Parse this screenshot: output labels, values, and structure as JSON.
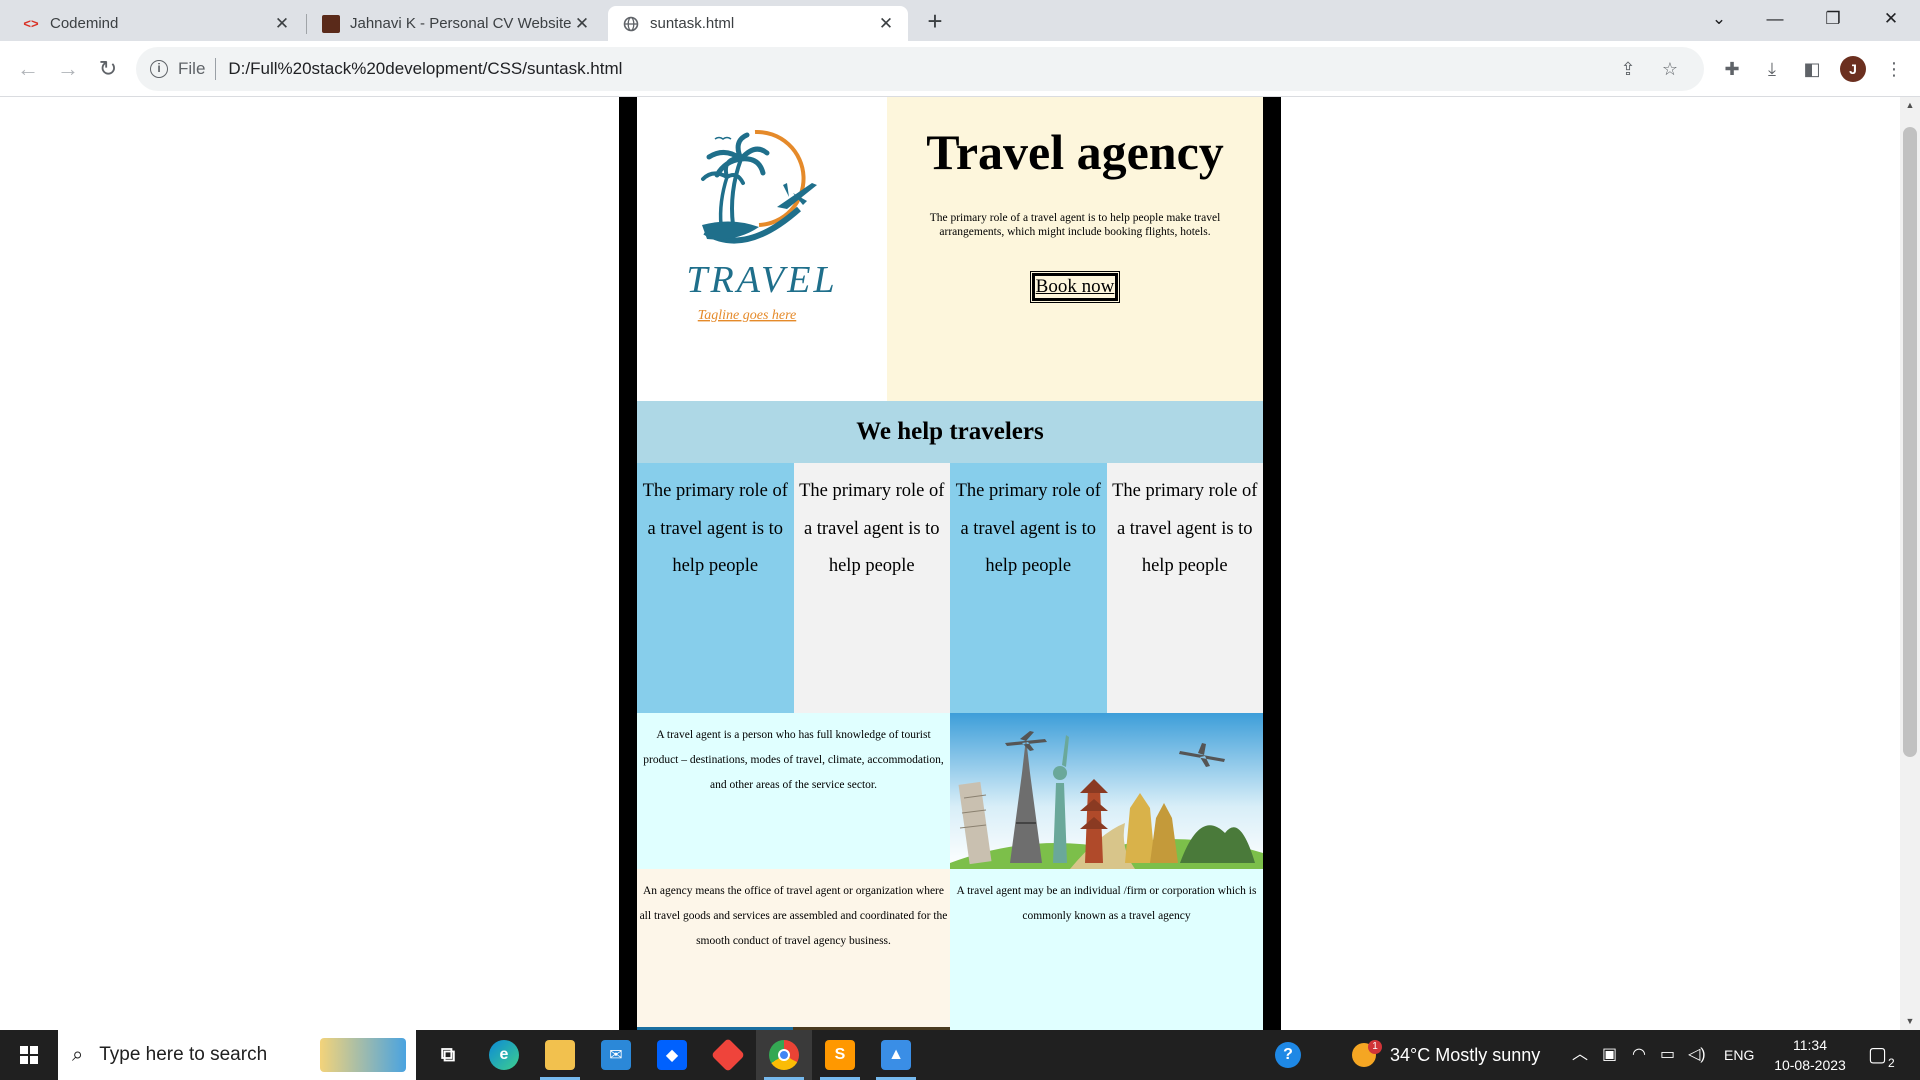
{
  "browser": {
    "tabs": [
      {
        "title": "Codemind",
        "favicon": "codemind-icon",
        "active": false
      },
      {
        "title": "Jahnavi K - Personal CV Website",
        "favicon": "portfolio-icon",
        "active": false
      },
      {
        "title": "suntask.html",
        "favicon": "globe-icon",
        "active": true
      }
    ],
    "address": {
      "scheme_label": "File",
      "url": "D:/Full%20stack%20development/CSS/suntask.html"
    },
    "profile_initial": "J"
  },
  "page": {
    "logo": {
      "wordmark": "TRAVEL",
      "tagline": "Tagline goes here"
    },
    "hero": {
      "title": "Travel agency",
      "description": "The primary role of a travel agent is to help people make travel arrangements, which might include booking flights, hotels.",
      "cta": "Book now"
    },
    "help_heading": "We help travelers",
    "columns": [
      {
        "text": "The primary role of a travel agent is to help people",
        "color": "#87ceeb"
      },
      {
        "text": "The primary role of a travel agent is to help people",
        "color": "#f2f2f2"
      },
      {
        "text": "The primary role of a travel agent is to help people",
        "color": "#87ceeb"
      },
      {
        "text": "The primary role of a travel agent is to help people",
        "color": "#f2f2f2"
      }
    ],
    "info_a": "A travel agent is a person who has full knowledge of tourist product – destinations, modes of travel, climate, accommodation, and other areas of the service sector.",
    "info_b": "An agency means the office of travel agent or organization where all travel goods and services are assembled and coordinated for the smooth conduct of travel agency business.",
    "info_c": "A travel agent may be an individual /firm or corporation which is commonly known as a travel agency",
    "colors": {
      "hero_bg": "#fdf6dc",
      "help_bg": "#aed8e6",
      "info_bg": "#e0ffff",
      "logo_teal": "#1f6f8b",
      "logo_orange": "#e58a2a"
    }
  },
  "taskbar": {
    "search_placeholder": "Type here to search",
    "weather": "34°C  Mostly sunny",
    "language": "ENG",
    "time": "11:34",
    "date": "10-08-2023",
    "notification_count": "2",
    "weather_badge": "1"
  }
}
